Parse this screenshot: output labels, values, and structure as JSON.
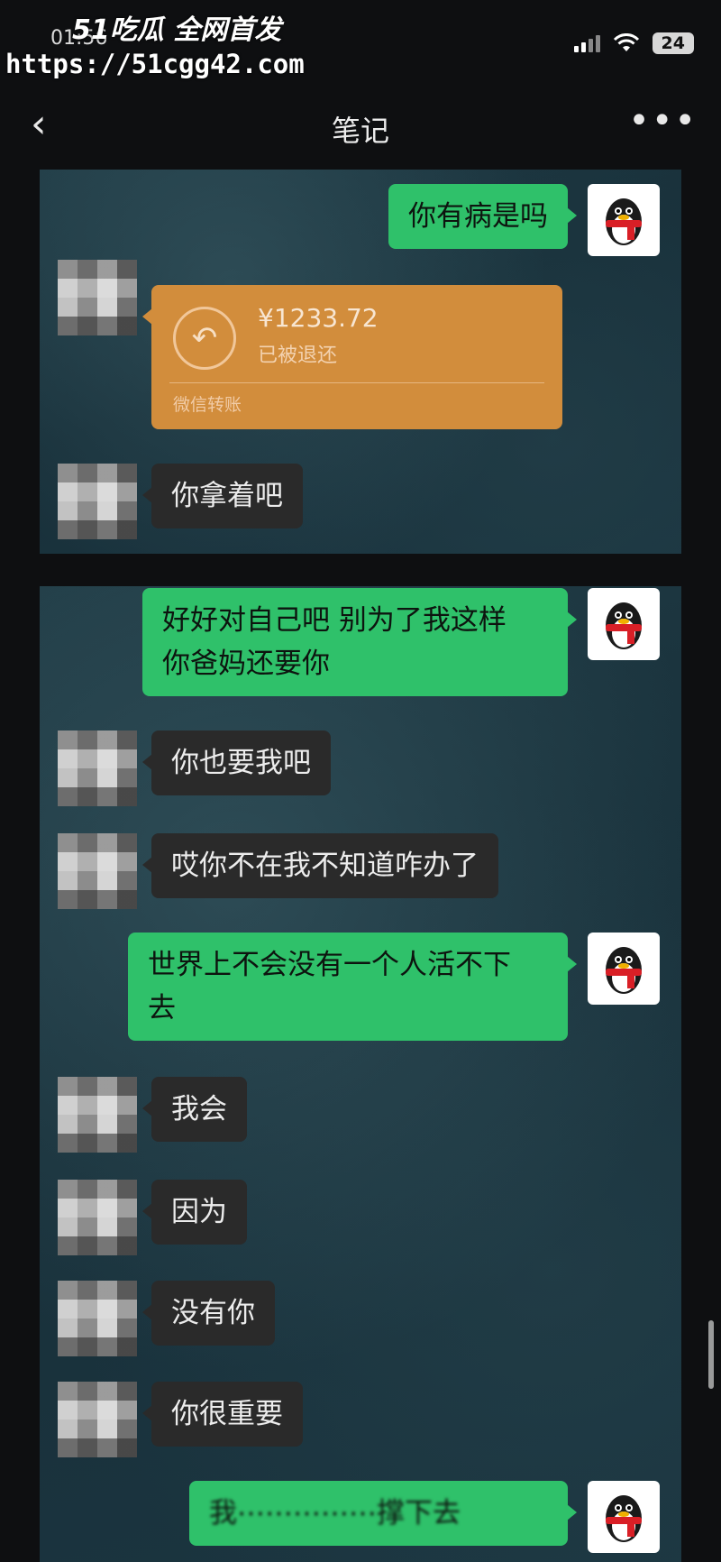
{
  "watermark": {
    "brand": "51吃瓜 全网首发",
    "url": "https://51cgg42.com"
  },
  "status_bar": {
    "time": "01:56",
    "battery": "24"
  },
  "nav": {
    "back_icon": "chevron-left-icon",
    "title": "笔记",
    "more_icon": "more-dots-icon"
  },
  "panel1": {
    "messages": [
      {
        "side": "self",
        "text": "你有病是吗"
      },
      {
        "side": "other",
        "type": "transfer",
        "amount": "¥1233.72",
        "status": "已被退还",
        "label": "微信转账",
        "icon": "return-arrow-icon"
      },
      {
        "side": "other",
        "text": "你拿着吧"
      }
    ]
  },
  "panel2": {
    "messages": [
      {
        "side": "self",
        "lines": [
          "好好对自己吧 别为了我这样",
          "你爸妈还要你"
        ]
      },
      {
        "side": "other",
        "text": "你也要我吧"
      },
      {
        "side": "other",
        "text": "哎你不在我不知道咋办了"
      },
      {
        "side": "self",
        "lines": [
          "世界上不会没有一个人活不下",
          "去"
        ]
      },
      {
        "side": "other",
        "text": "我会"
      },
      {
        "side": "other",
        "text": "因为"
      },
      {
        "side": "other",
        "text": "没有你"
      },
      {
        "side": "other",
        "text": "你很重要"
      },
      {
        "side": "self",
        "text": "我⋯⋯⋯⋯⋯撑下去"
      }
    ]
  },
  "colors": {
    "green_bubble": "#2fc16a",
    "gray_bubble": "#2a2a2a",
    "transfer_card": "#d28d3c"
  }
}
